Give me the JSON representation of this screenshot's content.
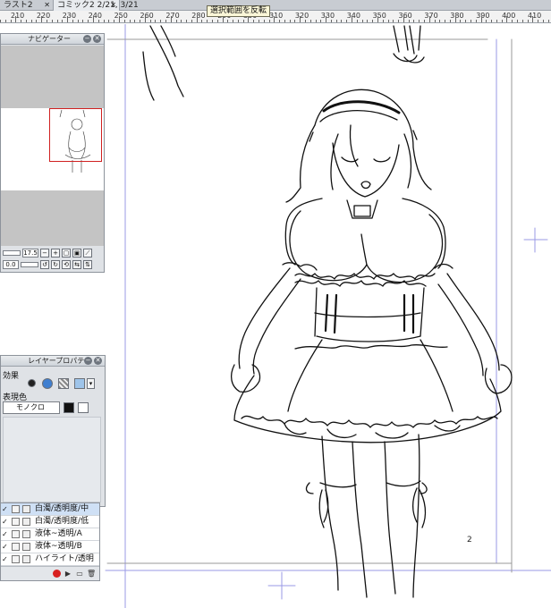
{
  "doc_tabs": [
    {
      "label": "ラスト2"
    },
    {
      "label": "コミック2 2/21, 3/21"
    }
  ],
  "tooltip": "選択範囲を反転",
  "ruler": {
    "labels": [
      "210",
      "220",
      "230",
      "240",
      "250",
      "260",
      "270",
      "280",
      "290",
      "300",
      "310",
      "320",
      "330",
      "340",
      "350",
      "360",
      "370",
      "380",
      "390",
      "400",
      "410"
    ]
  },
  "navigator": {
    "title": "ナビゲーター",
    "zoom_value": "17.5",
    "rotation_value": "0.0"
  },
  "layer_property": {
    "title": "レイヤープロパティ",
    "effect_label": "効果",
    "color_label": "表現色",
    "color_mode": "モノクロ"
  },
  "layers": [
    {
      "name": "白濁/透明度/中",
      "selected": true
    },
    {
      "name": "白濁/透明度/低",
      "selected": false
    },
    {
      "name": "液体~透明/A",
      "selected": false
    },
    {
      "name": "液体~透明/B",
      "selected": false
    },
    {
      "name": "ハイライト/透明",
      "selected": false
    }
  ],
  "canvas": {
    "page_number": "2"
  },
  "colors": {
    "panel_bg": "#dfe2e6",
    "nav_frame": "#d02020",
    "guide": "#9a9ae6",
    "record": "#d82020"
  }
}
